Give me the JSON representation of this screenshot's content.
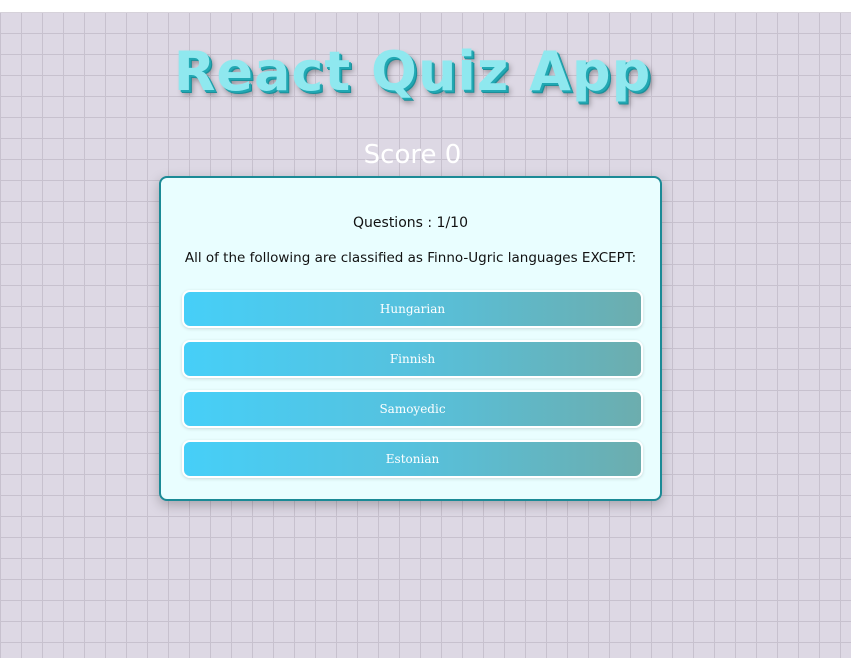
{
  "app": {
    "title": "React Quiz App",
    "score_text": "Score 0"
  },
  "quiz": {
    "question_counter": "Questions : 1/10",
    "question": "All of the following are classified as Finno-Ugric languages EXCEPT:",
    "answers": [
      {
        "label": "Hungarian"
      },
      {
        "label": "Finnish"
      },
      {
        "label": "Samoyedic"
      },
      {
        "label": "Estonian"
      }
    ]
  },
  "colors": {
    "title_fill": "#8fe8ef",
    "title_shadow": "#21a8b3",
    "card_background": "#e9feff",
    "card_border": "#1b8a96",
    "button_gradient_start": "#46cff8",
    "button_gradient_end": "#6cadae",
    "background": "#ddd8e4"
  }
}
